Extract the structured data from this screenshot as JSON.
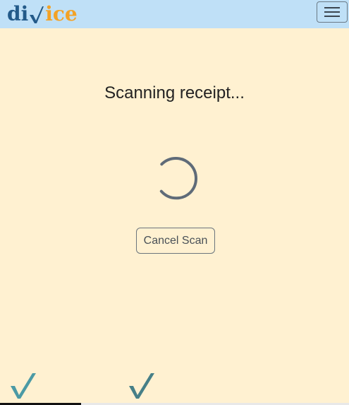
{
  "header": {
    "logo": {
      "prefix": "di",
      "suffix": "ice",
      "prefix_color": "#235a89",
      "check_color": "#235a89",
      "suffix_color": "#f3a226"
    },
    "menu_icon": "hamburger-icon",
    "background": "#bfe0f7"
  },
  "main": {
    "title": "Scanning receipt...",
    "spinner_icon": "loading-spinner-icon",
    "cancel_label": "Cancel Scan",
    "background": "#fff1d1"
  },
  "footer": {
    "watermark_icon": "checkmark-icon",
    "watermark_color": "#4b8f9b"
  }
}
